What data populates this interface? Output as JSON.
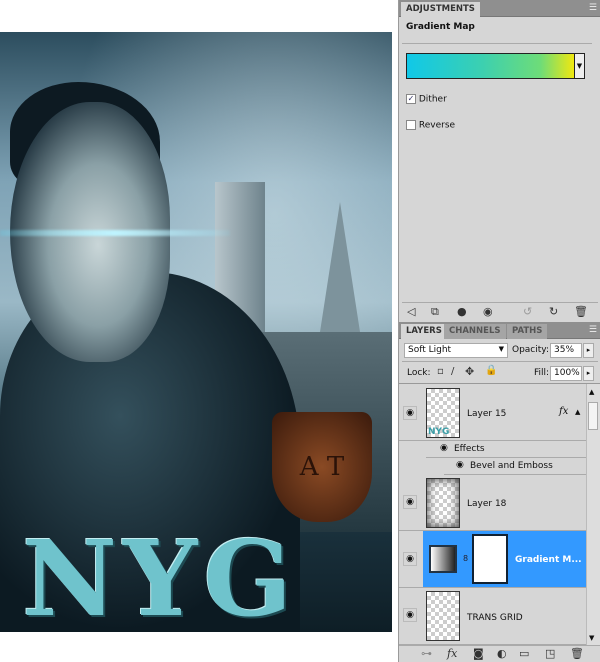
{
  "poster": {
    "title_text": "NYG",
    "shield_text": "A T"
  },
  "adjustments": {
    "tab_label": "ADJUSTMENTS",
    "title": "Gradient Map",
    "gradient_colors": [
      "#10c8e8",
      "#6edc78",
      "#f0e810"
    ],
    "dither_label": "Dither",
    "dither_checked": true,
    "reverse_label": "Reverse",
    "reverse_checked": false
  },
  "layers_panel": {
    "tabs": [
      "LAYERS",
      "CHANNELS",
      "PATHS"
    ],
    "blend_mode": "Soft Light",
    "opacity_label": "Opacity:",
    "opacity_value": "35%",
    "lock_label": "Lock:",
    "fill_label": "Fill:",
    "fill_value": "100%",
    "layers": [
      {
        "name": "Layer 15",
        "thumb_text": "NYG",
        "fx": "fx",
        "effects_label": "Effects",
        "effect": "Bevel and Emboss"
      },
      {
        "name": "Layer 18"
      },
      {
        "name": "Gradient M...",
        "selected": true
      },
      {
        "name": "TRANS GRID"
      }
    ],
    "accent_color": "#3399ff"
  }
}
